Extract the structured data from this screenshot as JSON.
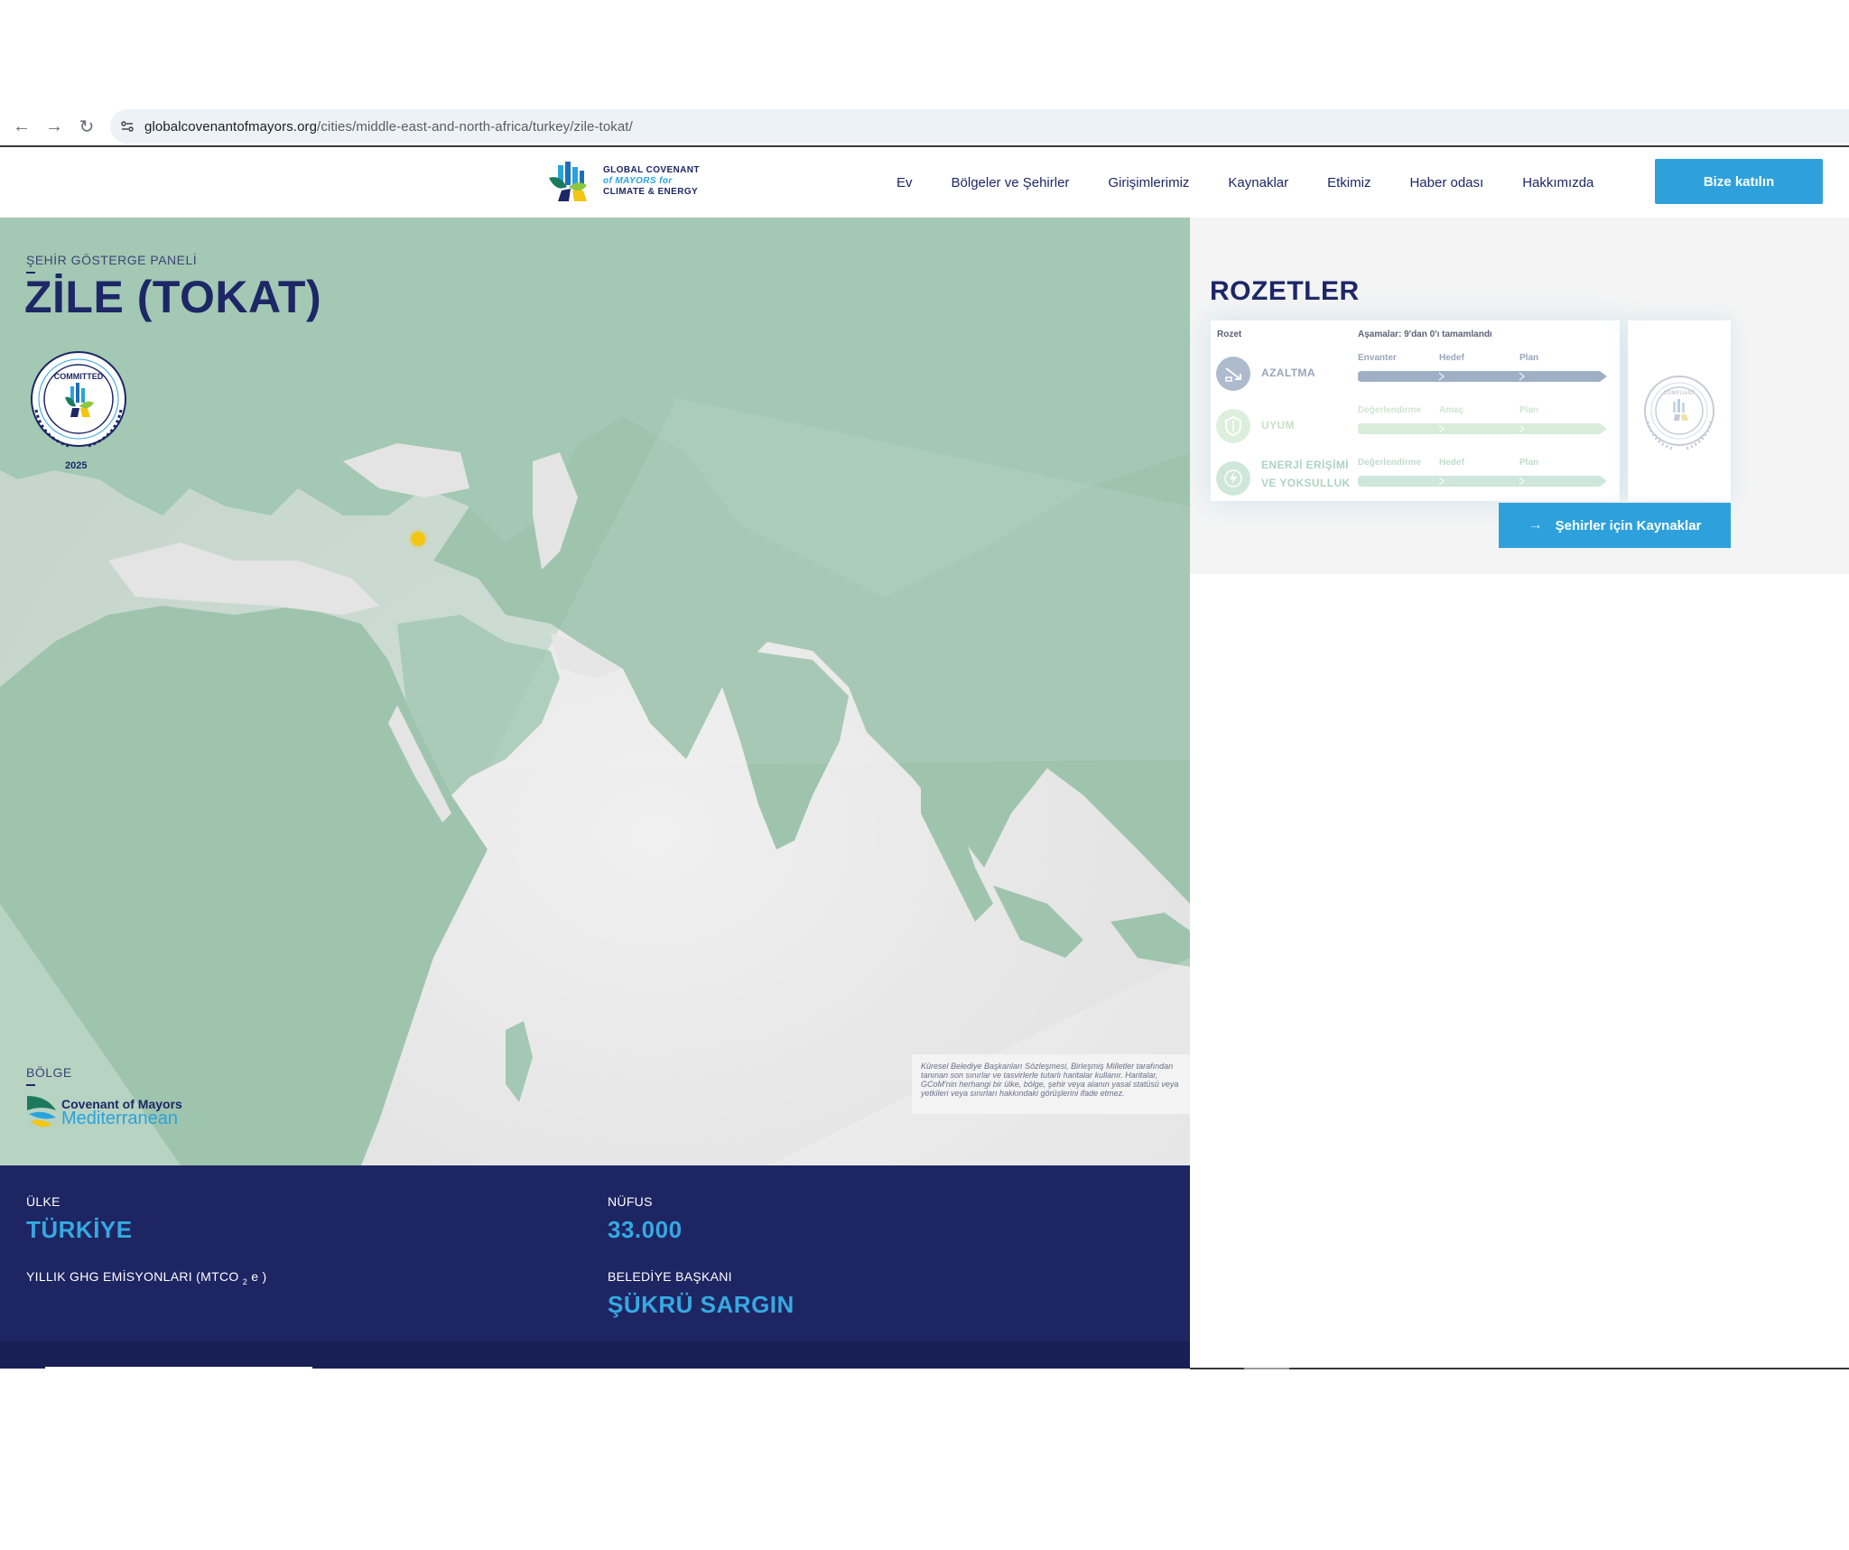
{
  "browser": {
    "url_domain": "globalcovenantofmayors.org",
    "url_path": "/cities/middle-east-and-north-africa/turkey/zile-tokat/",
    "back_icon": "arrow-left-icon",
    "forward_icon": "arrow-right-icon",
    "reload_icon": "reload-icon",
    "site_info_icon": "tune-icon"
  },
  "header": {
    "logo_lines": [
      "GLOBAL COVENANT",
      "of MAYORS for",
      "CLIMATE & ENERGY"
    ],
    "nav": [
      "Ev",
      "Bölgeler ve Şehirler",
      "Girişimlerimiz",
      "Kaynaklar",
      "Etkimiz",
      "Haber odası",
      "Hakkımızda"
    ],
    "join_label": "Bize katılın"
  },
  "hero": {
    "dashboard_label": "ŞEHİR GÖSTERGE PANELİ",
    "city_name": "ZİLE (TOKAT)",
    "badge_text": "COMMITTED",
    "badge_year": "2025",
    "region_label": "BÖLGE",
    "region_logo_line1": "Covenant of Mayors",
    "region_logo_line2": "Mediterranean",
    "map_disclaimer": "Küresel Belediye Başkanları Sözleşmesi, Birleşmiş Milletler tarafından tanınan son sınırlar ve tasvirlerle tutarlı haritalar kullanır. Haritalar, GCoM'nin herhangi bir ülke, bölge, şehir veya alanın yasal statüsü veya yetkileri veya sınırları hakkındaki görüşlerini ifade etmez."
  },
  "stats": {
    "country_label": "ÜLKE",
    "country_value": "TÜRKİYE",
    "population_label": "NÜFUS",
    "population_value": "33.000",
    "ghg_label": "YILLIK GHG EMİSYONLARI (MTCO",
    "ghg_sub": "2",
    "ghg_suffix": "e )",
    "mayor_label": "BELEDİYE BAŞKANI",
    "mayor_value": "ŞÜKRÜ SARGIN"
  },
  "badges": {
    "title": "ROZETLER",
    "col_badge": "Rozet",
    "col_stages": "Aşamalar: 9'dan 0'ı tamamlandı",
    "rows": [
      {
        "name1": "AZALTMA",
        "name2": "",
        "stages": [
          "Envanter",
          "Hedef",
          "Plan"
        ],
        "icon": "mitigation-icon",
        "color": "#9fb0c6",
        "text_color": "#98a6ba"
      },
      {
        "name1": "UYUM",
        "name2": "",
        "stages": [
          "Değerlendirme",
          "Amaç",
          "Plan"
        ],
        "icon": "shield-icon",
        "color": "#d9ecd9",
        "text_color": "#c6e2c6"
      },
      {
        "name1": "ENERJİ ERİŞİMİ",
        "name2": "VE YOKSULLUK",
        "stages": [
          "Değerlendirme",
          "Hedef",
          "Plan"
        ],
        "icon": "lightning-icon",
        "color": "#cfe6dc",
        "text_color": "#acd4c2"
      }
    ],
    "side_badge_text": "COMPLIANT",
    "resources_label": "Şehirler için Kaynaklar"
  }
}
